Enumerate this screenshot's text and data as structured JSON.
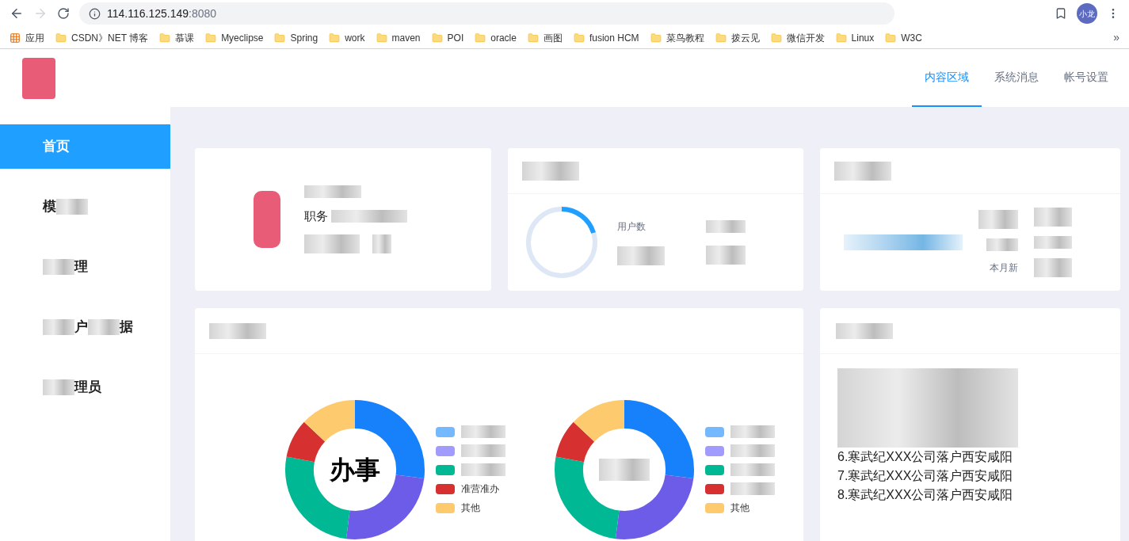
{
  "browser": {
    "url_host": "114.116.125.149",
    "url_port": ":8080",
    "profile": "小龙",
    "bookmarks_overflow": "»",
    "bookmarks": [
      {
        "label": "应用",
        "kind": "apps"
      },
      {
        "label": "CSDN》NET 博客",
        "kind": "folder"
      },
      {
        "label": "慕课",
        "kind": "folder"
      },
      {
        "label": "Myeclipse",
        "kind": "folder"
      },
      {
        "label": "Spring",
        "kind": "folder"
      },
      {
        "label": "work",
        "kind": "folder"
      },
      {
        "label": "maven",
        "kind": "folder"
      },
      {
        "label": "POI",
        "kind": "folder"
      },
      {
        "label": "oracle",
        "kind": "folder"
      },
      {
        "label": "画图",
        "kind": "folder"
      },
      {
        "label": "fusion HCM",
        "kind": "folder"
      },
      {
        "label": "菜鸟教程",
        "kind": "folder"
      },
      {
        "label": "拨云见",
        "kind": "folder"
      },
      {
        "label": "微信开发",
        "kind": "folder"
      },
      {
        "label": "Linux",
        "kind": "folder"
      },
      {
        "label": "W3C",
        "kind": "folder"
      }
    ]
  },
  "header_tabs": [
    {
      "label": "内容区域",
      "selected": true
    },
    {
      "label": "系统消息",
      "selected": false
    },
    {
      "label": "帐号设置",
      "selected": false
    }
  ],
  "sidebar": [
    {
      "selected": true,
      "parts": [
        {
          "kind": "text",
          "text": "首页"
        }
      ]
    },
    {
      "selected": false,
      "parts": [
        {
          "kind": "text",
          "text": "模"
        },
        {
          "kind": "blur"
        }
      ]
    },
    {
      "selected": false,
      "parts": [
        {
          "kind": "blur"
        },
        {
          "kind": "text",
          "text": "理"
        }
      ]
    },
    {
      "selected": false,
      "parts": [
        {
          "kind": "blur"
        },
        {
          "kind": "text",
          "text": "户"
        },
        {
          "kind": "blur"
        },
        {
          "kind": "text",
          "text": "据"
        }
      ]
    },
    {
      "selected": false,
      "parts": [
        {
          "kind": "blur"
        },
        {
          "kind": "text",
          "text": "理员"
        }
      ]
    }
  ],
  "user_card": {
    "role_fragment": "职务"
  },
  "users_card": {
    "label_fragment": "用户数"
  },
  "stats_card": {
    "label_fragment": "本月新"
  },
  "charts": [
    {
      "center": "办事",
      "legend": [
        {
          "kind": "blur",
          "color": "#74b9ff"
        },
        {
          "kind": "blur",
          "color": "#a29bfe"
        },
        {
          "kind": "blur",
          "color": "#00b894"
        },
        {
          "kind": "text",
          "text": "准营准办",
          "color": "#d63031"
        },
        {
          "kind": "text",
          "text": "其他",
          "color": "#fdcb6e"
        }
      ]
    },
    {
      "legend": [
        {
          "kind": "blur",
          "color": "#74b9ff"
        },
        {
          "kind": "blur",
          "color": "#a29bfe"
        },
        {
          "kind": "blur",
          "color": "#00b894"
        },
        {
          "kind": "blur",
          "color": "#d63031"
        },
        {
          "kind": "text",
          "text": "其他",
          "color": "#fdcb6e"
        }
      ]
    }
  ],
  "news": [
    "6.寒武纪XXX公司落户西安咸阳",
    "7.寒武纪XXX公司落户西安咸阳",
    "8.寒武纪XXX公司落户西安咸阳"
  ]
}
